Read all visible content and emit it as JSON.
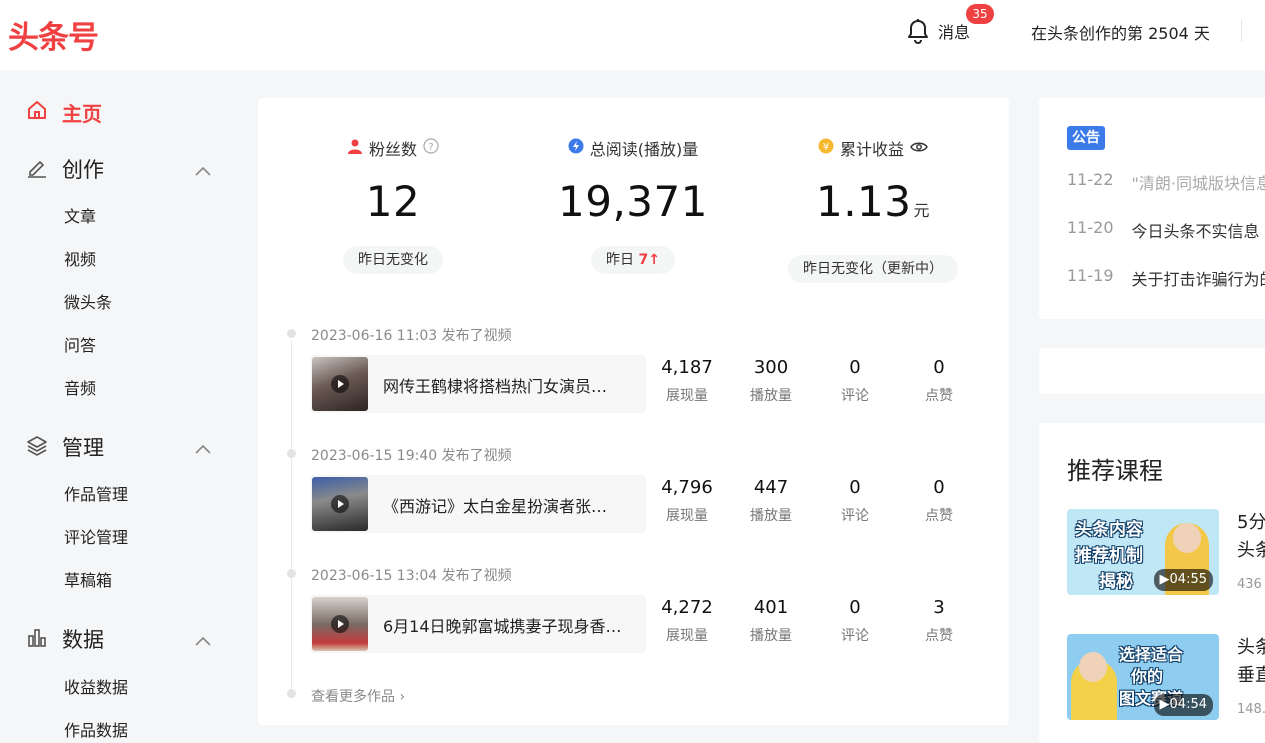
{
  "header": {
    "logo": "头条号",
    "message_label": "消息",
    "message_badge": "35",
    "days_text": "在头条创作的第 2504 天"
  },
  "sidebar": {
    "home": "主页",
    "groups": [
      {
        "label": "创作",
        "items": [
          "文章",
          "视频",
          "微头条",
          "问答",
          "音频"
        ]
      },
      {
        "label": "管理",
        "items": [
          "作品管理",
          "评论管理",
          "草稿箱"
        ]
      },
      {
        "label": "数据",
        "items": [
          "收益数据",
          "作品数据"
        ]
      }
    ]
  },
  "stats": [
    {
      "label": "粉丝数",
      "value": "12",
      "unit": "",
      "change": "昨日无变化"
    },
    {
      "label": "总阅读(播放)量",
      "value": "19,371",
      "unit": "",
      "change_prefix": "昨日",
      "change_value": "7"
    },
    {
      "label": "累计收益",
      "value": "1.13",
      "unit": "元",
      "change": "昨日无变化（更新中）"
    }
  ],
  "works": [
    {
      "meta": "2023-06-16 11:03  发布了视频",
      "title": "网传王鹤棣将搭档热门女演员…",
      "impressions": "4,187",
      "plays": "300",
      "comments": "0",
      "likes": "0"
    },
    {
      "meta": "2023-06-15 19:40  发布了视频",
      "title": "《西游记》太白金星扮演者张…",
      "impressions": "4,796",
      "plays": "447",
      "comments": "0",
      "likes": "0"
    },
    {
      "meta": "2023-06-15 13:04  发布了视频",
      "title": "6月14日晚郭富城携妻子现身香…",
      "impressions": "4,272",
      "plays": "401",
      "comments": "0",
      "likes": "3"
    }
  ],
  "metric_labels": {
    "impressions": "展现量",
    "plays": "播放量",
    "comments": "评论",
    "likes": "点赞"
  },
  "more_link": "查看更多作品",
  "announcements": {
    "tag": "公告",
    "items": [
      {
        "date": "11-22",
        "text": "\"清朗·同城版块信息"
      },
      {
        "date": "11-20",
        "text": "今日头条不实信息"
      },
      {
        "date": "11-19",
        "text": "关于打击诈骗行为的"
      }
    ]
  },
  "courses": {
    "title": "推荐课程",
    "items": [
      {
        "thumb_text_1": "头条内容",
        "thumb_text_2": "推荐机制",
        "thumb_text_3": "揭秘",
        "duration": "04:55",
        "title_1": "5分",
        "title_2": "头条",
        "sub": "436"
      },
      {
        "thumb_text_1": "选择适合",
        "thumb_text_2": "你的",
        "thumb_text_3": "图文赛道",
        "duration": "04:54",
        "title_1": "头条",
        "title_2": "垂直",
        "sub": "148."
      }
    ]
  },
  "colors": {
    "brand": "#f04142",
    "tag_blue": "#3a7be9"
  }
}
